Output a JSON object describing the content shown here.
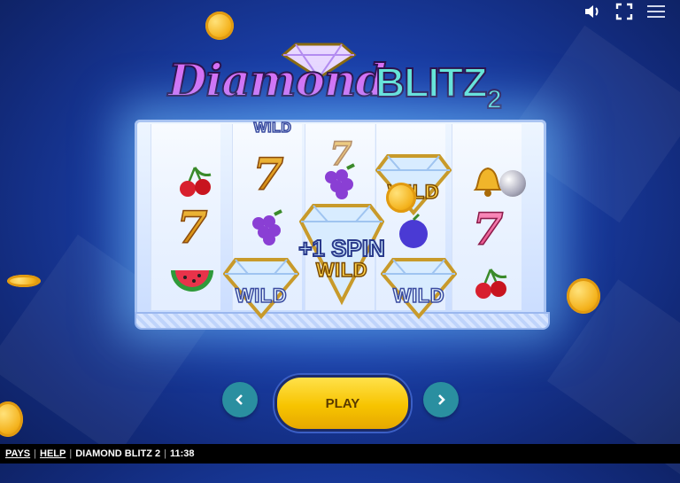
{
  "logo": {
    "word1": "Diamond",
    "word2": "BLITZ",
    "word3": "2"
  },
  "top_controls": {
    "sound_icon": "speaker-icon",
    "fullscreen_icon": "fullscreen-icon",
    "menu_icon": "hamburger-menu-icon"
  },
  "reels": {
    "top_wild_label": "WILD",
    "wild_label": "WILD",
    "spin_label": "+1 SPIN",
    "seven": "7"
  },
  "controls": {
    "play_label": "PLAY",
    "prev_icon": "chevron-left-icon",
    "next_icon": "chevron-right-icon"
  },
  "footer": {
    "pays": "PAYS",
    "help": "HELP",
    "game_name": "DIAMOND BLITZ 2",
    "time": "11:38"
  },
  "colors": {
    "play": "#f7c400",
    "nav": "#2a8fa0",
    "background": "#1a3fa8",
    "footer": "#000000"
  }
}
